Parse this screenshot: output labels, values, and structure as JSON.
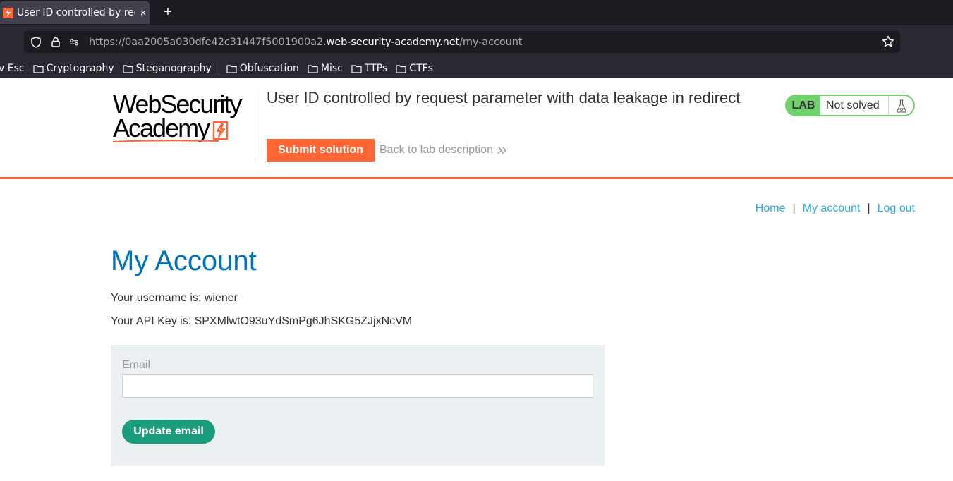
{
  "browser": {
    "tab": {
      "title": "User ID controlled by requ",
      "close": "×"
    },
    "new_tab": "+",
    "url": {
      "prefix": "https://0aa2005a030dfe42c31447f5001900a2.",
      "host": "web-security-academy.net",
      "path": "/my-account"
    },
    "bookmarks": [
      "v Esc",
      "Cryptography",
      "Steganography",
      "Obfuscation",
      "Misc",
      "TTPs",
      "CTFs"
    ]
  },
  "header": {
    "logo_line1": "WebSecurity",
    "logo_line2": "Academy",
    "lab_title": "User ID controlled by request parameter with data leakage in redirect",
    "submit_label": "Submit solution",
    "back_label": "Back to lab description",
    "badge": {
      "lab": "LAB",
      "status": "Not solved"
    }
  },
  "nav": {
    "home": "Home",
    "sep1": "|",
    "account": "My account",
    "sep2": "|",
    "logout": "Log out"
  },
  "main": {
    "title": "My Account",
    "username_line": "Your username is: wiener",
    "apikey_line": "Your API Key is: SPXMlwtO93uYdSmPg6JhSKG5ZJjxNcVM",
    "email_label": "Email",
    "email_value": "",
    "update_label": "Update email"
  },
  "colors": {
    "accent": "#ff6633",
    "link": "#29abe0",
    "title": "#0071bc",
    "button": "#1a9c7d",
    "badge": "#70d16d"
  }
}
